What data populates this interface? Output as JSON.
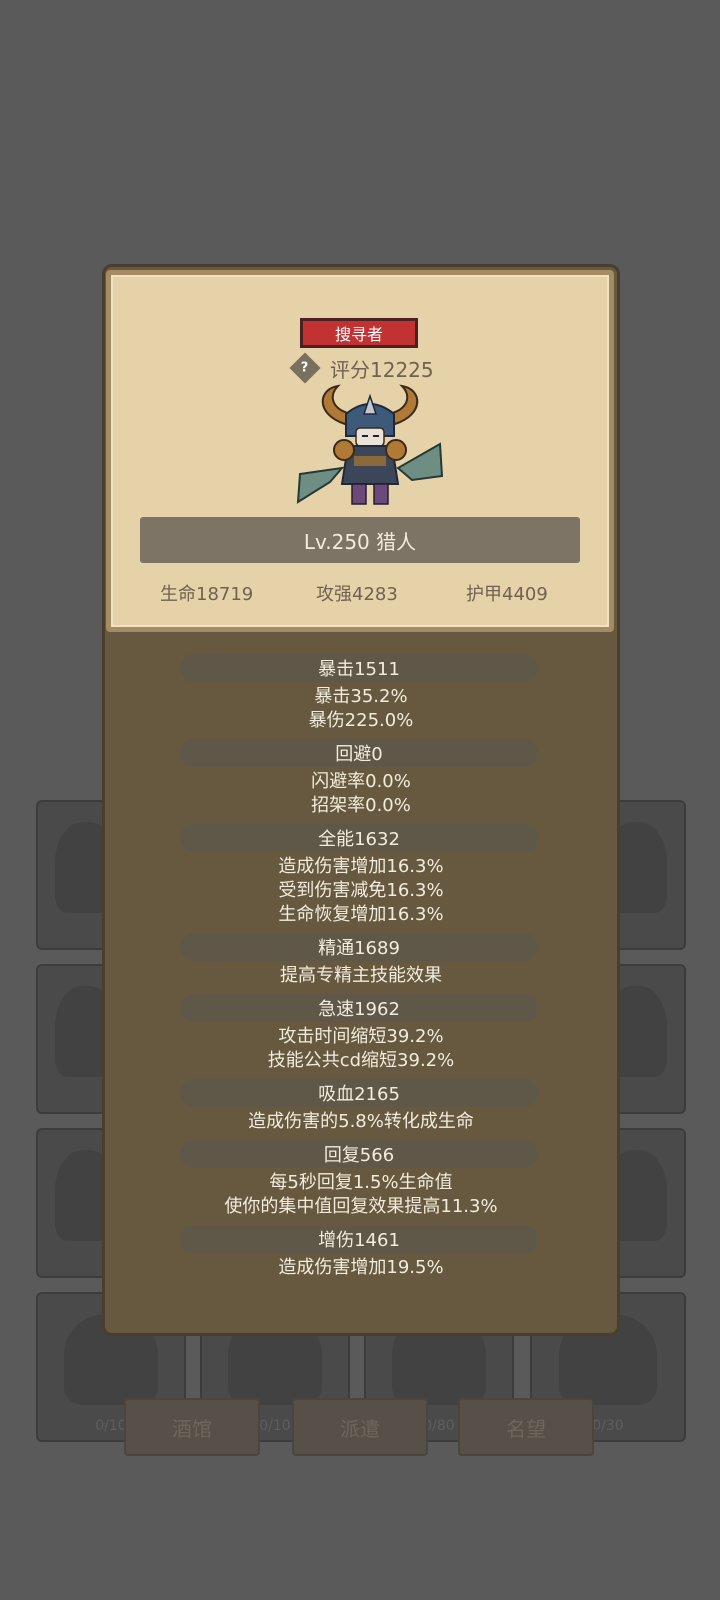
{
  "background": {
    "slot_counts": [
      "0/10",
      "0/10",
      "0/80",
      "0/30"
    ],
    "buttons": [
      "酒馆",
      "派遣",
      "名望"
    ]
  },
  "hero": {
    "class_badge": "搜寻者",
    "score": "评分12225",
    "help_icon": "?",
    "level_label": "Lv.250 猎人",
    "base_stats": {
      "hp": "生命18719",
      "attack": "攻强4283",
      "armor": "护甲4409"
    }
  },
  "stats": [
    {
      "header": "暴击1511",
      "lines": [
        "暴击35.2%",
        "暴伤225.0%"
      ]
    },
    {
      "header": "回避0",
      "lines": [
        "闪避率0.0%",
        "招架率0.0%"
      ]
    },
    {
      "header": "全能1632",
      "lines": [
        "造成伤害增加16.3%",
        "受到伤害减免16.3%",
        "生命恢复增加16.3%"
      ]
    },
    {
      "header": "精通1689",
      "lines": [
        "提高专精主技能效果"
      ]
    },
    {
      "header": "急速1962",
      "lines": [
        "攻击时间缩短39.2%",
        "技能公共cd缩短39.2%"
      ]
    },
    {
      "header": "吸血2165",
      "lines": [
        "造成伤害的5.8%转化成生命"
      ]
    },
    {
      "header": "回复566",
      "lines": [
        "每5秒回复1.5%生命值",
        "使你的集中值回复效果提高11.3%"
      ]
    },
    {
      "header": "增伤1461",
      "lines": [
        "造成伤害增加19.5%"
      ]
    }
  ],
  "colors": {
    "badge_red": "#c23232",
    "card_parchment": "#e6d2a8",
    "panel_brown": "#67593f"
  }
}
